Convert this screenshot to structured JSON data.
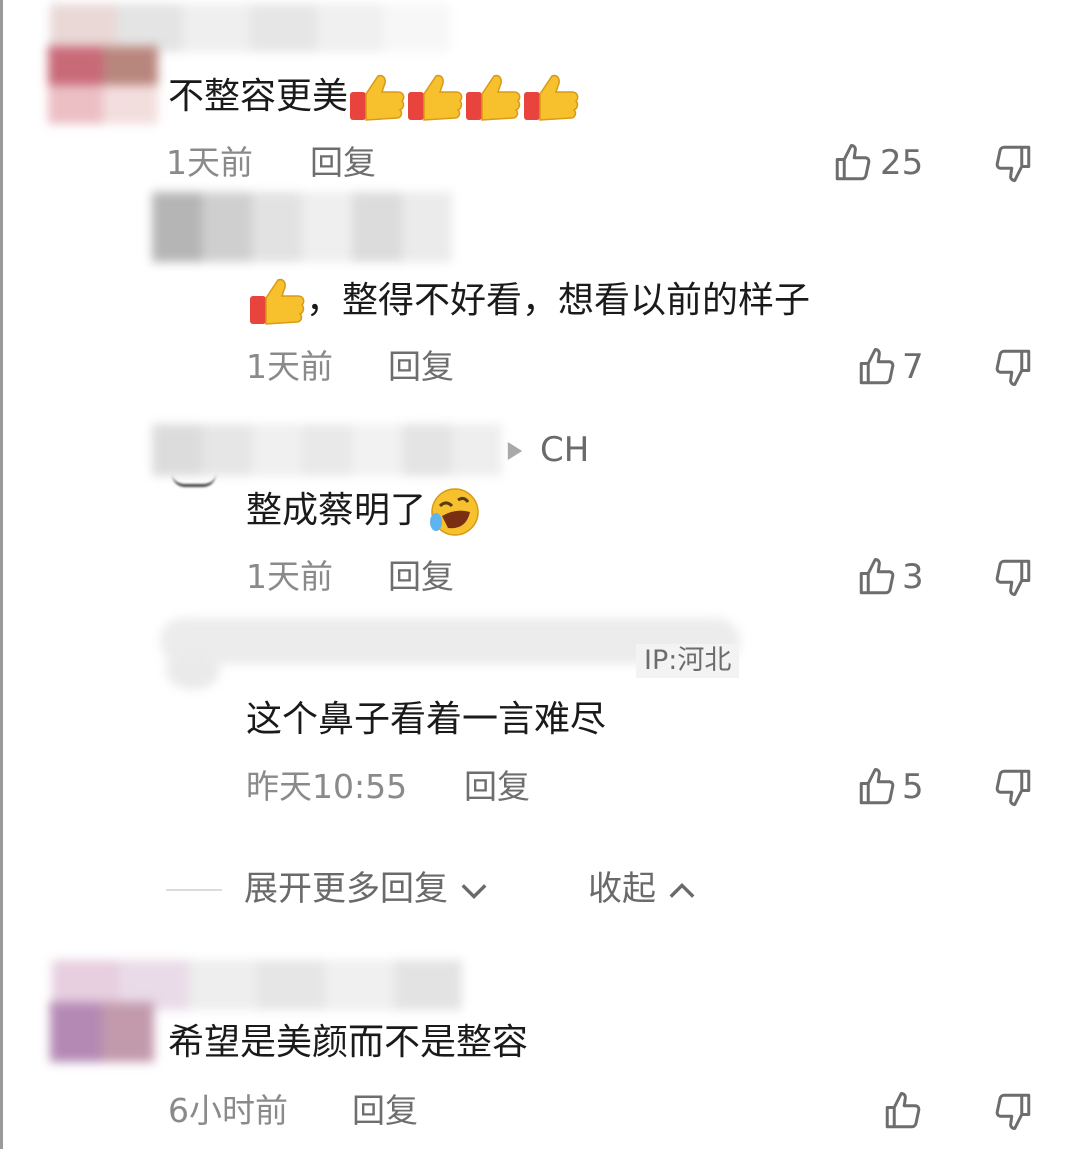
{
  "comments": [
    {
      "text": "不整容更美",
      "time": "1天前",
      "reply_label": "回复",
      "likes": "25",
      "emoji_count": 4
    },
    {
      "text": "，整得不好看，想看以前的样子",
      "time": "1天前",
      "reply_label": "回复",
      "likes": "7"
    },
    {
      "reply_to": "CH",
      "text": "整成蔡明了",
      "time": "1天前",
      "reply_label": "回复",
      "likes": "3"
    },
    {
      "location": "IP:河北",
      "text": "这个鼻子看着一言难尽",
      "time": "昨天10:55",
      "reply_label": "回复",
      "likes": "5"
    },
    {
      "text": "希望是美颜而不是整容",
      "time": "6小时前",
      "reply_label": "回复",
      "likes": ""
    }
  ],
  "thread_controls": {
    "expand_label": "展开更多回复",
    "collapse_label": "收起"
  },
  "icons": [
    "thumbs-up-emoji",
    "rolling-laughing-emoji",
    "like-icon",
    "dislike-icon",
    "chevron-down-icon",
    "chevron-up-icon",
    "reply-arrow-icon"
  ],
  "colors": {
    "text": "#1a1a1a",
    "meta": "#8a8a8a",
    "emoji_yellow": "#f7c12e",
    "emoji_sleeve": "#e8443d"
  }
}
